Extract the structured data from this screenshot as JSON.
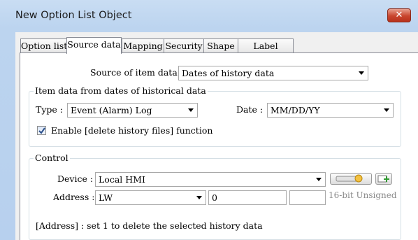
{
  "window": {
    "title": "New Option List Object",
    "close_glyph": "✕"
  },
  "tabs": [
    {
      "label": "Option list"
    },
    {
      "label": "Source data"
    },
    {
      "label": "Mapping"
    },
    {
      "label": "Security"
    },
    {
      "label": "Shape"
    },
    {
      "label": "Label"
    }
  ],
  "source": {
    "label": "Source of item data :",
    "value": "Dates of history data"
  },
  "history_group": {
    "title": "Item data from dates of historical data",
    "type_label": "Type :",
    "type_value": "Event (Alarm) Log",
    "date_label": "Date :",
    "date_value": "MM/DD/YY",
    "enable_checked": true,
    "enable_label": "Enable [delete history files] function"
  },
  "control_group": {
    "title": "Control",
    "device_label": "Device :",
    "device_value": "Local HMI",
    "address_label": "Address :",
    "address_type": "LW",
    "address_value": "0",
    "data_format": "16-bit Unsigned",
    "note": "[Address] : set 1 to delete the selected history data"
  },
  "icons": {
    "settings_icon": "device-settings-icon",
    "add_icon": "add-icon"
  }
}
